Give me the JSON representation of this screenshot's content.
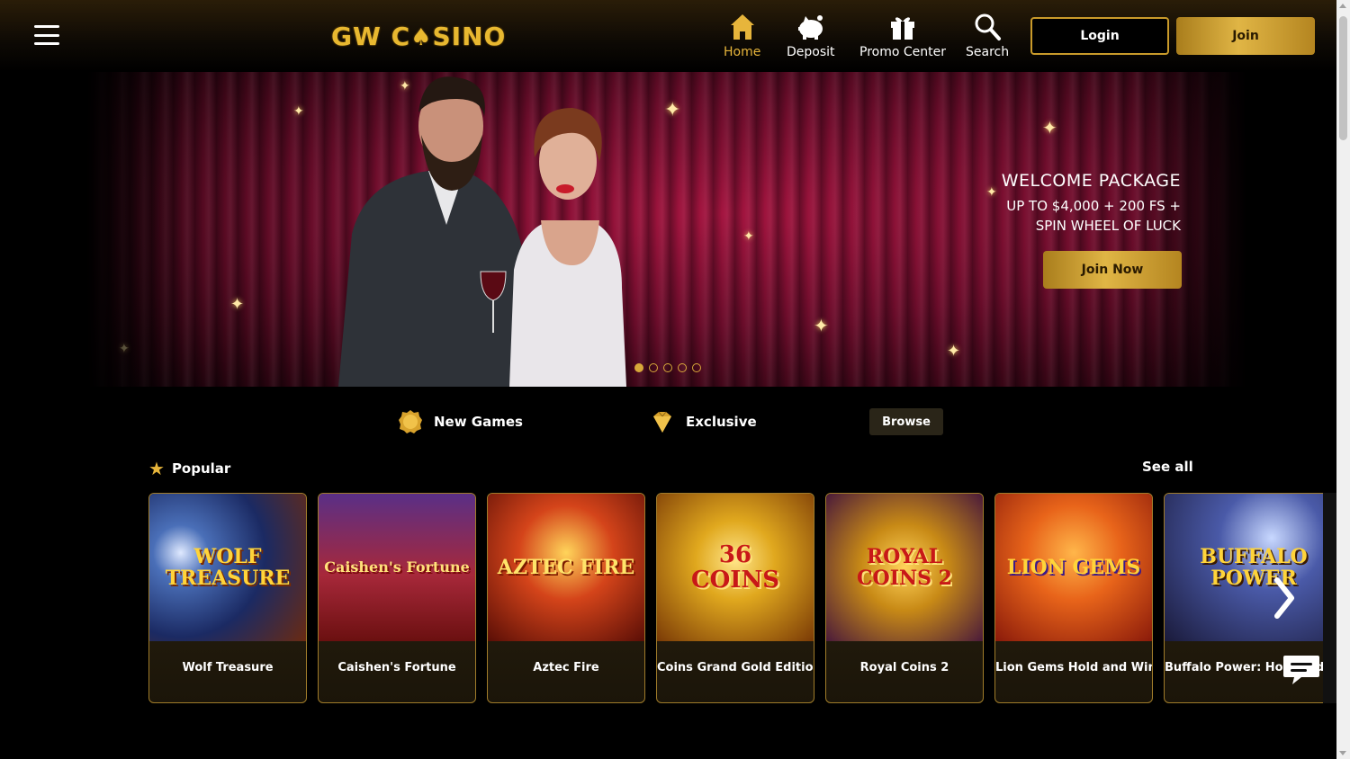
{
  "brand": {
    "logo_text_left": "GW C",
    "logo_text_right": "SINO",
    "accent": "#e7b53b"
  },
  "nav": {
    "menu_icon": "hamburger-menu-icon",
    "items": [
      {
        "label": "Home",
        "icon": "home-icon",
        "active": true
      },
      {
        "label": "Deposit",
        "icon": "piggy-bank-icon",
        "active": false
      },
      {
        "label": "Promo Center",
        "icon": "gift-icon",
        "active": false
      },
      {
        "label": "Search",
        "icon": "search-icon",
        "active": false
      }
    ],
    "login_label": "Login",
    "join_label": "Join"
  },
  "hero": {
    "title": "WELCOME PACKAGE",
    "line1": "UP TO $4,000 + 200 FS +",
    "line2": "SPIN WHEEL OF LUCK",
    "cta_label": "Join Now",
    "slides_count": 5,
    "active_slide": 1
  },
  "categories": {
    "new_games": "New Games",
    "exclusive": "Exclusive",
    "browse": "Browse"
  },
  "popular": {
    "title": "Popular",
    "see_all": "See all",
    "games": [
      {
        "name": "Wolf Treasure",
        "art": "WOLF\nTREASURE"
      },
      {
        "name": "Caishen's Fortune",
        "art": "Caishen's Fortune"
      },
      {
        "name": "Aztec Fire",
        "art": "AZTEC FIRE"
      },
      {
        "name": "Coins Grand Gold Edition",
        "art": "36\nCOINS"
      },
      {
        "name": "Royal Coins 2",
        "art": "ROYAL\nCOINS 2"
      },
      {
        "name": "Lion Gems Hold and Win",
        "art": "LION GEMS"
      },
      {
        "name": "Buffalo Power: Hold and Win",
        "art": "BUFFALO\nPOWER"
      }
    ]
  }
}
